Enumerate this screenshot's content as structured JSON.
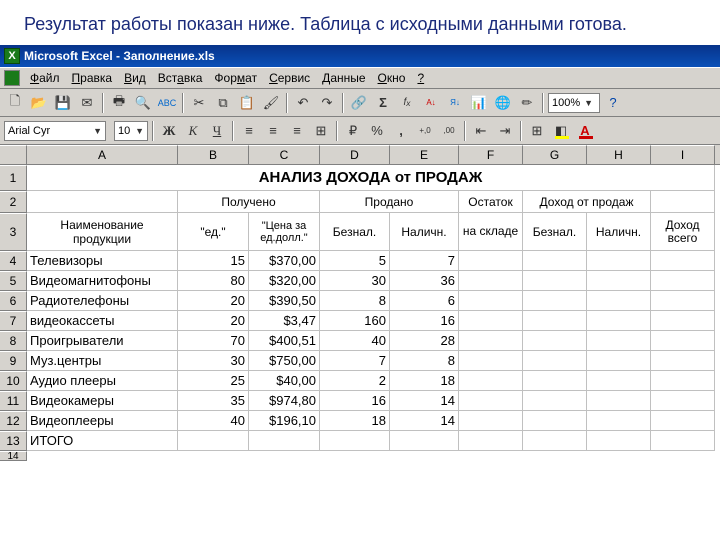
{
  "caption": "Результат  работы показан ниже. Таблица с исходными данными готова.",
  "title_app": "Microsoft Excel",
  "title_doc": "Заполнение.xls",
  "menu": [
    "Файл",
    "Правка",
    "Вид",
    "Вставка",
    "Формат",
    "Сервис",
    "Данные",
    "Окно",
    "?"
  ],
  "zoom": "100%",
  "font": {
    "name": "Arial Cyr",
    "size": "10"
  },
  "columns": [
    "A",
    "B",
    "C",
    "D",
    "E",
    "F",
    "G",
    "H",
    "I"
  ],
  "sheet_title": "АНАЛИЗ ДОХОДА от ПРОДАЖ",
  "headers": {
    "r2": {
      "A": "",
      "B_merged": "Получено",
      "D_merged": "Продано",
      "F": "Остаток",
      "G_merged": "Доход от продаж"
    },
    "r3": {
      "A": "Наименование продукции",
      "B": "\"ед.\"",
      "C": "\"Цена за ед.долл.\"",
      "D": "Безнал.",
      "E": "Наличн.",
      "F": "на складе",
      "G": "Безнал.",
      "H": "Наличн.",
      "I": "Доход всего"
    }
  },
  "rows": [
    {
      "n": 4,
      "A": "Телевизоры",
      "B": "15",
      "C": "$370,00",
      "D": "5",
      "E": "7"
    },
    {
      "n": 5,
      "A": "Видеомагнитофоны",
      "B": "80",
      "C": "$320,00",
      "D": "30",
      "E": "36"
    },
    {
      "n": 6,
      "A": "Радиотелефоны",
      "B": "20",
      "C": "$390,50",
      "D": "8",
      "E": "6"
    },
    {
      "n": 7,
      "A": "видеокассеты",
      "B": "20",
      "C": "$3,47",
      "D": "160",
      "E": "16"
    },
    {
      "n": 8,
      "A": "Проигрыватели",
      "B": "70",
      "C": "$400,51",
      "D": "40",
      "E": "28"
    },
    {
      "n": 9,
      "A": "Муз.центры",
      "B": "30",
      "C": "$750,00",
      "D": "7",
      "E": "8"
    },
    {
      "n": 10,
      "A": "Аудио плееры",
      "B": "25",
      "C": "$40,00",
      "D": "2",
      "E": "18"
    },
    {
      "n": 11,
      "A": "Видеокамеры",
      "B": "35",
      "C": "$974,80",
      "D": "16",
      "E": "14"
    },
    {
      "n": 12,
      "A": "Видеоплееры",
      "B": "40",
      "C": "$196,10",
      "D": "18",
      "E": "14"
    },
    {
      "n": 13,
      "A": "ИТОГО"
    }
  ],
  "chart_data": {
    "type": "table",
    "title": "АНАЛИЗ ДОХОДА от ПРОДАЖ",
    "columns": [
      "Наименование продукции",
      "Получено ед.",
      "Цена за ед. долл.",
      "Продано Безнал.",
      "Продано Наличн.",
      "Остаток на складе",
      "Доход Безнал.",
      "Доход Наличн.",
      "Доход всего"
    ],
    "data": [
      [
        "Телевизоры",
        15,
        370.0,
        5,
        7,
        null,
        null,
        null,
        null
      ],
      [
        "Видеомагнитофоны",
        80,
        320.0,
        30,
        36,
        null,
        null,
        null,
        null
      ],
      [
        "Радиотелефоны",
        20,
        390.5,
        8,
        6,
        null,
        null,
        null,
        null
      ],
      [
        "видеокассеты",
        20,
        3.47,
        160,
        16,
        null,
        null,
        null,
        null
      ],
      [
        "Проигрыватели",
        70,
        400.51,
        40,
        28,
        null,
        null,
        null,
        null
      ],
      [
        "Муз.центры",
        30,
        750.0,
        7,
        8,
        null,
        null,
        null,
        null
      ],
      [
        "Аудио плееры",
        25,
        40.0,
        2,
        18,
        null,
        null,
        null,
        null
      ],
      [
        "Видеокамеры",
        35,
        974.8,
        16,
        14,
        null,
        null,
        null,
        null
      ],
      [
        "Видеоплееры",
        40,
        196.1,
        18,
        14,
        null,
        null,
        null,
        null
      ]
    ]
  }
}
